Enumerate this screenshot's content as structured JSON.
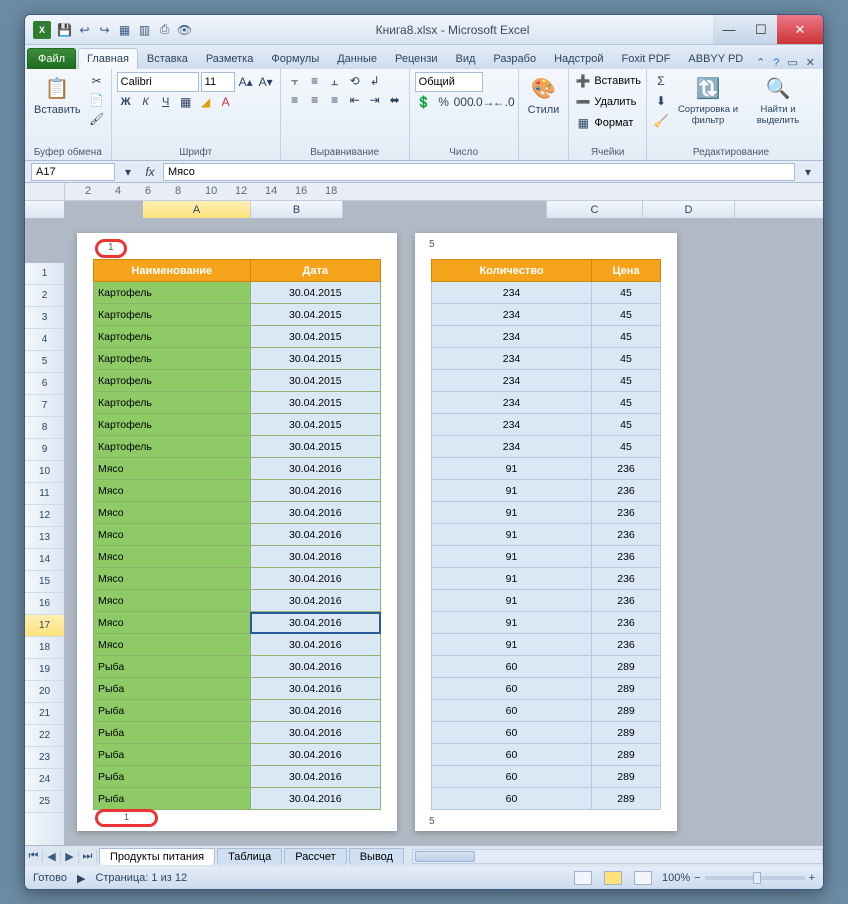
{
  "title": "Книга8.xlsx - Microsoft Excel",
  "qat": [
    "💾",
    "↩",
    "↪",
    "▦",
    "▥",
    "⎙",
    "👁"
  ],
  "tabs": {
    "file": "Файл",
    "items": [
      "Главная",
      "Вставка",
      "Разметка",
      "Формулы",
      "Данные",
      "Рецензи",
      "Вид",
      "Разрабо",
      "Надстрой",
      "Foxit PDF",
      "ABBYY PD"
    ],
    "active": 0
  },
  "ribbon": {
    "clipboard": {
      "label": "Буфер обмена",
      "paste": "Вставить"
    },
    "font": {
      "label": "Шрифт",
      "name": "Calibri",
      "size": "11"
    },
    "align": {
      "label": "Выравнивание"
    },
    "number": {
      "label": "Число",
      "fmt": "Общий"
    },
    "styles": {
      "label": "Стили",
      "btn": "Стили"
    },
    "cells": {
      "label": "Ячейки",
      "insert": "Вставить",
      "delete": "Удалить",
      "format": "Формат"
    },
    "edit": {
      "label": "Редактирование",
      "sort": "Сортировка и фильтр",
      "find": "Найти и выделить"
    }
  },
  "formula": {
    "name": "A17",
    "fx": "Мясо"
  },
  "ruler": [
    "2",
    "4",
    "6",
    "8",
    "10",
    "12",
    "14",
    "16",
    "18"
  ],
  "cols": [
    "A",
    "B",
    "C",
    "D"
  ],
  "pageNums": {
    "leftTop": "1",
    "leftBot": "1",
    "rightTop": "5",
    "rightBot": "5"
  },
  "headers": {
    "left": [
      "Наименование",
      "Дата"
    ],
    "right": [
      "Количество",
      "Цена"
    ]
  },
  "rows": [
    {
      "n": "Картофель",
      "d": "30.04.2015",
      "q": "234",
      "p": "45"
    },
    {
      "n": "Картофель",
      "d": "30.04.2015",
      "q": "234",
      "p": "45"
    },
    {
      "n": "Картофель",
      "d": "30.04.2015",
      "q": "234",
      "p": "45"
    },
    {
      "n": "Картофель",
      "d": "30.04.2015",
      "q": "234",
      "p": "45"
    },
    {
      "n": "Картофель",
      "d": "30.04.2015",
      "q": "234",
      "p": "45"
    },
    {
      "n": "Картофель",
      "d": "30.04.2015",
      "q": "234",
      "p": "45"
    },
    {
      "n": "Картофель",
      "d": "30.04.2015",
      "q": "234",
      "p": "45"
    },
    {
      "n": "Картофель",
      "d": "30.04.2015",
      "q": "234",
      "p": "45"
    },
    {
      "n": "Мясо",
      "d": "30.04.2016",
      "q": "91",
      "p": "236"
    },
    {
      "n": "Мясо",
      "d": "30.04.2016",
      "q": "91",
      "p": "236"
    },
    {
      "n": "Мясо",
      "d": "30.04.2016",
      "q": "91",
      "p": "236"
    },
    {
      "n": "Мясо",
      "d": "30.04.2016",
      "q": "91",
      "p": "236"
    },
    {
      "n": "Мясо",
      "d": "30.04.2016",
      "q": "91",
      "p": "236"
    },
    {
      "n": "Мясо",
      "d": "30.04.2016",
      "q": "91",
      "p": "236"
    },
    {
      "n": "Мясо",
      "d": "30.04.2016",
      "q": "91",
      "p": "236"
    },
    {
      "n": "Мясо",
      "d": "30.04.2016",
      "q": "91",
      "p": "236"
    },
    {
      "n": "Мясо",
      "d": "30.04.2016",
      "q": "91",
      "p": "236"
    },
    {
      "n": "Рыба",
      "d": "30.04.2016",
      "q": "60",
      "p": "289"
    },
    {
      "n": "Рыба",
      "d": "30.04.2016",
      "q": "60",
      "p": "289"
    },
    {
      "n": "Рыба",
      "d": "30.04.2016",
      "q": "60",
      "p": "289"
    },
    {
      "n": "Рыба",
      "d": "30.04.2016",
      "q": "60",
      "p": "289"
    },
    {
      "n": "Рыба",
      "d": "30.04.2016",
      "q": "60",
      "p": "289"
    },
    {
      "n": "Рыба",
      "d": "30.04.2016",
      "q": "60",
      "p": "289"
    },
    {
      "n": "Рыба",
      "d": "30.04.2016",
      "q": "60",
      "p": "289"
    }
  ],
  "selectedRow": 17,
  "sheetTabs": [
    "Продукты питания",
    "Таблица",
    "Рассчет",
    "Вывод"
  ],
  "status": {
    "ready": "Готово",
    "page": "Страница: 1 из 12",
    "zoom": "100%"
  }
}
